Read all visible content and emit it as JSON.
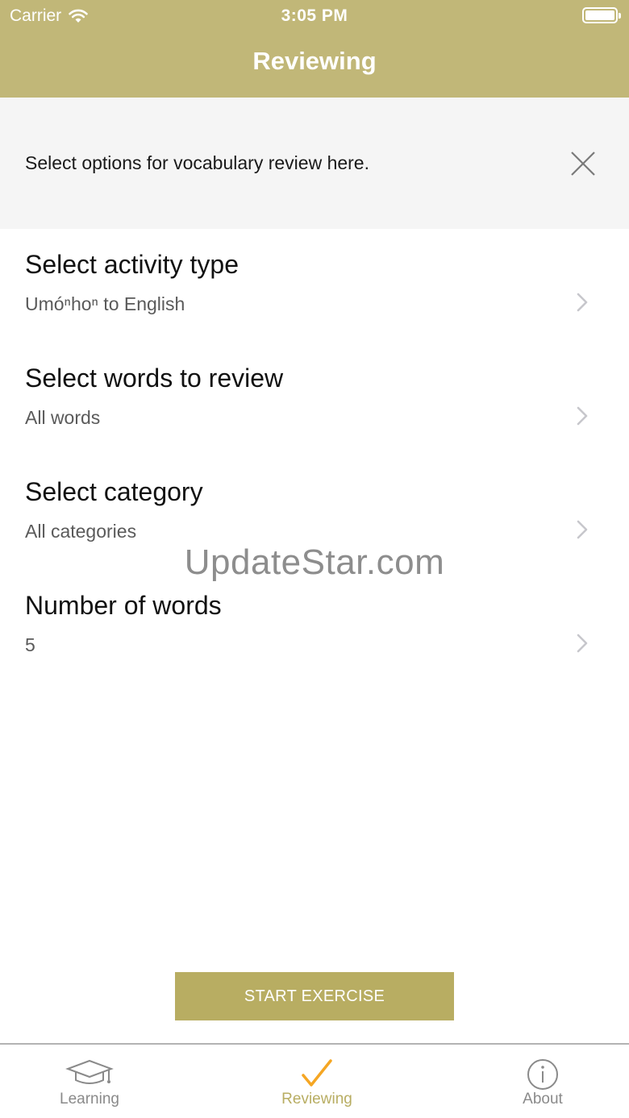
{
  "status_bar": {
    "carrier": "Carrier",
    "time": "3:05 PM"
  },
  "nav": {
    "title": "Reviewing"
  },
  "banner": {
    "message": "Select options for vocabulary review here."
  },
  "options": [
    {
      "title": "Select activity type",
      "value": "Umóⁿhoⁿ to English"
    },
    {
      "title": "Select words to review",
      "value": "All words"
    },
    {
      "title": "Select category",
      "value": "All categories"
    },
    {
      "title": "Number of words",
      "value": "5"
    }
  ],
  "watermark": "UpdateStar.com",
  "start_button": "START EXERCISE",
  "tabs": [
    {
      "label": "Learning",
      "icon": "graduation-cap-icon",
      "active": false
    },
    {
      "label": "Reviewing",
      "icon": "checkmark-icon",
      "active": true
    },
    {
      "label": "About",
      "icon": "info-icon",
      "active": false
    }
  ],
  "colors": {
    "brand": "#c1b778",
    "button": "#b8ad62",
    "banner_bg": "#f5f5f5",
    "tab_inactive": "#8a8a8a",
    "tab_active_check": "#f5a623"
  }
}
